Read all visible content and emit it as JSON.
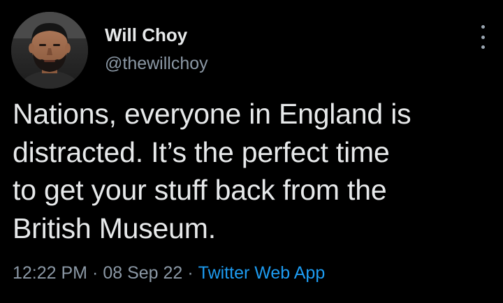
{
  "author": {
    "display_name": "Will Choy",
    "handle": "@thewillchoy"
  },
  "tweet": {
    "lines": [
      "Nations, everyone in England is",
      "distracted. It’s the perfect time",
      "to get your stuff back from the",
      "British Museum."
    ]
  },
  "meta": {
    "time": "12:22 PM",
    "separator": "·",
    "date": "08 Sep 22",
    "source": "Twitter Web App"
  },
  "icons": {
    "more": "more-horizontal-dots-icon",
    "avatar": "user-avatar-photo"
  },
  "colors": {
    "background": "#000000",
    "text_primary": "#e7e9ea",
    "text_secondary": "#8b98a5",
    "link": "#1d9bf0"
  }
}
